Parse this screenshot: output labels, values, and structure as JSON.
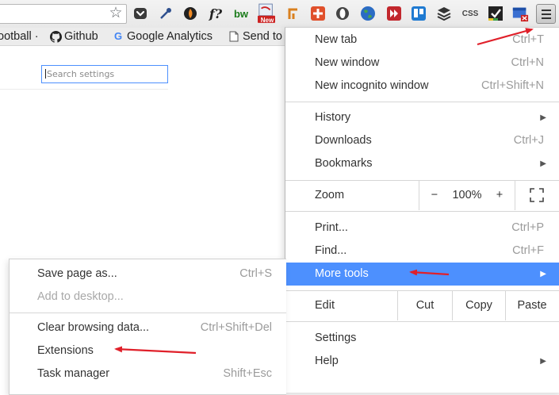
{
  "toolbar": {
    "extensions": [
      {
        "name": "pocket-icon",
        "glyph": "❤",
        "color": "#3a3a3a"
      },
      {
        "name": "eyedropper-icon",
        "glyph": "✎",
        "color": "#2d4f8e"
      },
      {
        "name": "swirl-icon",
        "glyph": "◐",
        "color": "#f08a24"
      },
      {
        "name": "fx-icon",
        "glyph": "f?",
        "color": "#222222"
      },
      {
        "name": "bw-icon",
        "glyph": "bw",
        "color": "#1a7b1a"
      },
      {
        "name": "new-badge-icon",
        "glyph": "New",
        "color": "#cc2222"
      },
      {
        "name": "pin-icon",
        "glyph": "┏",
        "color": "#d9801f"
      },
      {
        "name": "puzzle-icon",
        "glyph": "✚",
        "color": "#d94b2b"
      },
      {
        "name": "shield-icon",
        "glyph": "◯",
        "color": "#444444"
      },
      {
        "name": "globe-icon",
        "glyph": "●",
        "color": "#2b6cc4"
      },
      {
        "name": "forward-icon",
        "glyph": "»",
        "color": "#c2272d"
      },
      {
        "name": "trello-icon",
        "glyph": "▤",
        "color": "#1f7ad1"
      },
      {
        "name": "layers-icon",
        "glyph": "≋",
        "color": "#333333"
      },
      {
        "name": "css-icon",
        "glyph": "CSS",
        "color": "#444444"
      },
      {
        "name": "checkbox-icon",
        "glyph": "☑",
        "color": "#222222"
      },
      {
        "name": "window-close-icon",
        "glyph": "▬",
        "color": "#3a6fd1"
      }
    ],
    "new_badge": "New",
    "css_label": "CSS",
    "fx_label": "f?",
    "bw_label": "bw"
  },
  "bookmarks": [
    {
      "label": "ootball ·",
      "icon": ""
    },
    {
      "label": "Github",
      "icon": "github-icon"
    },
    {
      "label": "Google Analytics",
      "icon": "google-icon"
    },
    {
      "label": "Send to",
      "icon": "page-icon"
    }
  ],
  "page": {
    "search_placeholder": "Search settings"
  },
  "menu": {
    "new_tab": {
      "label": "New tab",
      "shortcut": "Ctrl+T"
    },
    "new_window": {
      "label": "New window",
      "shortcut": "Ctrl+N"
    },
    "new_incognito": {
      "label": "New incognito window",
      "shortcut": "Ctrl+Shift+N"
    },
    "history": {
      "label": "History"
    },
    "downloads": {
      "label": "Downloads",
      "shortcut": "Ctrl+J"
    },
    "bookmarks": {
      "label": "Bookmarks"
    },
    "zoom": {
      "label": "Zoom",
      "minus": "−",
      "value": "100%",
      "plus": "+"
    },
    "print": {
      "label": "Print...",
      "shortcut": "Ctrl+P"
    },
    "find": {
      "label": "Find...",
      "shortcut": "Ctrl+F"
    },
    "more_tools": {
      "label": "More tools"
    },
    "edit": {
      "label": "Edit",
      "cut": "Cut",
      "copy": "Copy",
      "paste": "Paste"
    },
    "settings": {
      "label": "Settings"
    },
    "help": {
      "label": "Help"
    }
  },
  "submenu": {
    "save_page": {
      "label": "Save page as...",
      "shortcut": "Ctrl+S"
    },
    "add_desktop": {
      "label": "Add to desktop..."
    },
    "clear_browsing": {
      "label": "Clear browsing data...",
      "shortcut": "Ctrl+Shift+Del"
    },
    "extensions": {
      "label": "Extensions"
    },
    "task_manager": {
      "label": "Task manager",
      "shortcut": "Shift+Esc"
    }
  },
  "colors": {
    "highlight": "#4d90fe",
    "annotation_arrow": "#e0202a",
    "disabled_text": "#a8a8a8",
    "shortcut_text": "#9b9b9b"
  }
}
